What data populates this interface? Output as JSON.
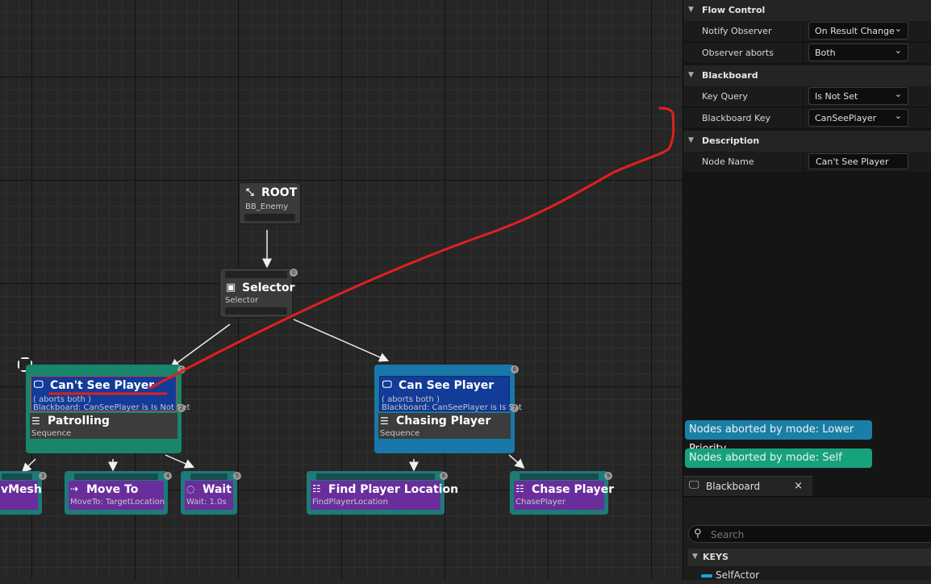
{
  "graph": {
    "root": {
      "title": "ROOT",
      "sub": "BB_Enemy"
    },
    "selector": {
      "title": "Selector",
      "sub": "Selector",
      "idx": "0"
    },
    "left_comp": {
      "deco_title": "Can't See Player",
      "deco_line1": "( aborts both )",
      "deco_line2": "Blackboard: CanSeePlayer is Is Not Set",
      "deco_idx": "1",
      "seq_title": "Patrolling",
      "seq_sub": "Sequence",
      "seq_idx": "2"
    },
    "right_comp": {
      "deco_title": "Can See Player",
      "deco_line1": "( aborts both )",
      "deco_line2": "Blackboard: CanSeePlayer is Is Set",
      "deco_idx": "6",
      "seq_title": "Chasing Player",
      "seq_sub": "Sequence",
      "seq_idx": "7"
    },
    "tasks": [
      {
        "title": "vMesh",
        "sub": "",
        "idx": "3"
      },
      {
        "title": "Move To",
        "sub": "MoveTo: TargetLocation",
        "idx": "4"
      },
      {
        "title": "Wait",
        "sub": "Wait: 1.0s",
        "idx": "5"
      },
      {
        "title": "Find Player Location",
        "sub": "FindPlayerLocation",
        "idx": "8"
      },
      {
        "title": "Chase Player",
        "sub": "ChasePlayer",
        "idx": "9"
      }
    ]
  },
  "details": {
    "flow_control": {
      "header": "Flow Control",
      "notify_observer": {
        "label": "Notify Observer",
        "value": "On Result Change"
      },
      "observer_aborts": {
        "label": "Observer aborts",
        "value": "Both"
      }
    },
    "blackboard": {
      "header": "Blackboard",
      "key_query": {
        "label": "Key Query",
        "value": "Is Not Set"
      },
      "blackboard_key": {
        "label": "Blackboard Key",
        "value": "CanSeePlayer"
      }
    },
    "description": {
      "header": "Description",
      "node_name": {
        "label": "Node Name",
        "value": "Can't See Player"
      }
    }
  },
  "legend": {
    "lower_priority": "Nodes aborted by mode: Lower Priority",
    "self": "Nodes aborted by mode: Self",
    "lower_priority_color": "#1a7fa8",
    "self_color": "#17a27e"
  },
  "blackboard_panel": {
    "tab_label": "Blackboard",
    "close": "×",
    "search_placeholder": "Search",
    "keys_header": "KEYS",
    "keys": [
      {
        "name": "SelfActor",
        "color": "#19a4e8"
      }
    ]
  }
}
